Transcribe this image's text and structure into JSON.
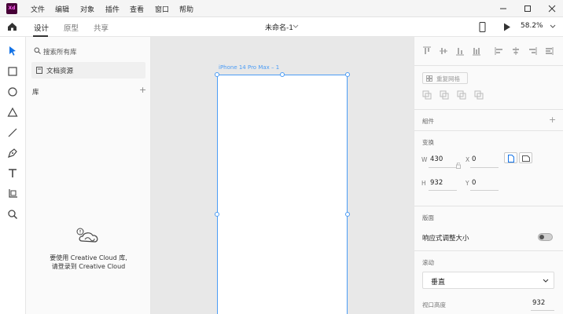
{
  "app": {
    "logo_text": "Xd",
    "menu": [
      "文件",
      "编辑",
      "对象",
      "插件",
      "查看",
      "窗口",
      "帮助"
    ]
  },
  "toolbar": {
    "tabs": [
      "设计",
      "原型",
      "共享"
    ],
    "doc_title": "未命名-1",
    "zoom": "58.2%"
  },
  "assets": {
    "search_placeholder": "搜索所有库",
    "doc_assets": "文档资源",
    "library_label": "库",
    "cc_message_line1": "要使用 Creative Cloud 库,",
    "cc_message_line2": "请登录到 Creative Cloud"
  },
  "canvas": {
    "artboard_name": "iPhone 14 Pro Max – 1"
  },
  "inspector": {
    "repeat_grid": "重复网格",
    "components_label": "組件",
    "transform_label": "变换",
    "w_label": "W",
    "w_value": "430",
    "x_label": "X",
    "x_value": "0",
    "h_label": "H",
    "h_value": "932",
    "y_label": "Y",
    "y_value": "0",
    "layout_label": "版面",
    "responsive_resize": "响应式调整大小",
    "scroll_label": "滚动",
    "scroll_value": "垂直",
    "viewport_height_label": "视口高度",
    "viewport_height_value": "932"
  },
  "colors": {
    "accent": "#4b9cf5",
    "brand": "#470137"
  }
}
